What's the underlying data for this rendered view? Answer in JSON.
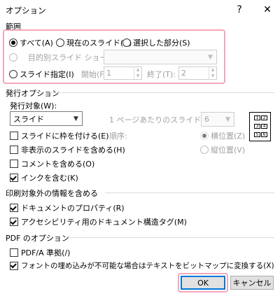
{
  "window": {
    "title": "オプション",
    "help_glyph": "?",
    "close_glyph": "✕"
  },
  "range": {
    "label": "範囲",
    "all": "すべて(A)",
    "current": "現在のスライド(C)",
    "selection": "選択した部分(S)",
    "custom_show": "目的別スライド ショー(O):",
    "slides": "スライド指定(I)",
    "from_label": "開始(F):",
    "from_value": "1",
    "to_label": "終了(T):",
    "to_value": "2"
  },
  "publish": {
    "label": "発行オプション",
    "target_label": "発行対象(W):",
    "target_value": "スライド",
    "per_page_label": "1 ページあたりのスライド数(L):",
    "per_page_value": "6",
    "order_label": "順序:",
    "horizontal": "横位置(Z)",
    "vertical": "縦位置(V)",
    "frame": "スライドに枠を付ける(E)",
    "hidden": "非表示のスライドを含める(H)",
    "comments": "コメントを含める(O)",
    "ink": "インクを含む(K)",
    "layout_cells": [
      "1",
      "2",
      "3",
      "4",
      "5",
      "6"
    ]
  },
  "non_print": {
    "label": "印刷対象外の情報を含める",
    "properties": "ドキュメントのプロパティ(R)",
    "tags": "アクセシビリティ用のドキュメント構造タグ(M)"
  },
  "pdf": {
    "label": "PDF のオプション",
    "pdfa": "PDF/A 準拠(/)",
    "bitmap": "フォントの埋め込みが不可能な場合はテキストをビットマップに変換する(X)"
  },
  "buttons": {
    "ok": "OK",
    "cancel": "キャンセル"
  },
  "colors": {
    "highlight": "#f4a7b9",
    "focus": "#0078d7"
  }
}
